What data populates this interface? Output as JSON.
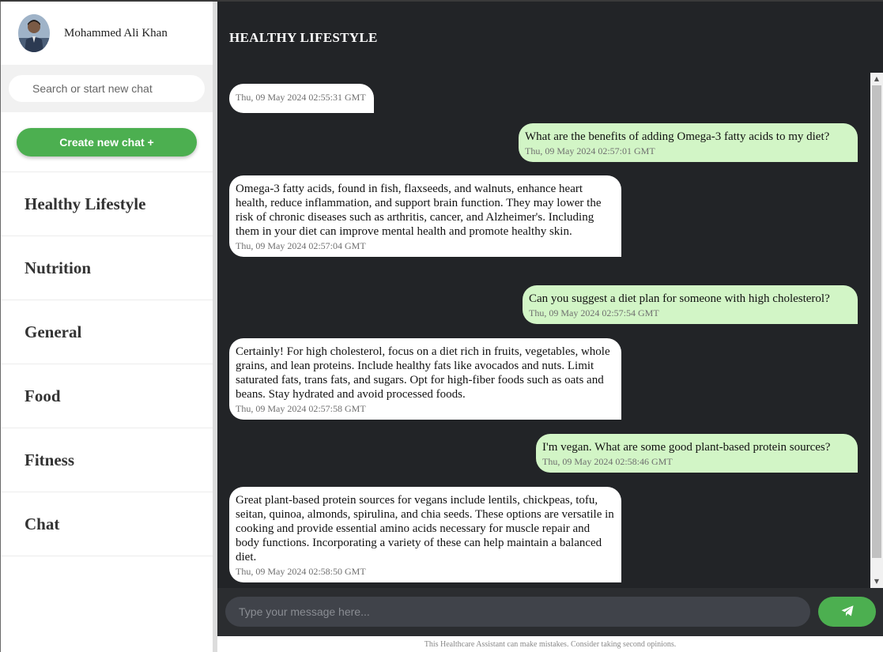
{
  "profile": {
    "name": "Mohammed Ali Khan"
  },
  "search": {
    "placeholder": "Search or start new chat"
  },
  "sidebar": {
    "new_chat_label": "Create new chat +",
    "items": [
      {
        "label": "Healthy Lifestyle"
      },
      {
        "label": "Nutrition"
      },
      {
        "label": "General"
      },
      {
        "label": "Food"
      },
      {
        "label": "Fitness"
      },
      {
        "label": "Chat"
      }
    ]
  },
  "main": {
    "title": "HEALTHY LIFESTYLE",
    "messages": [
      {
        "role": "bot",
        "text": "",
        "time": "Thu, 09 May 2024 02:55:31 GMT"
      },
      {
        "role": "user",
        "text": "What are the benefits of adding Omega-3 fatty acids to my diet?",
        "time": "Thu, 09 May 2024 02:57:01 GMT"
      },
      {
        "role": "bot",
        "text": "Omega-3 fatty acids, found in fish, flaxseeds, and walnuts, enhance heart health, reduce inflammation, and support brain function. They may lower the risk of chronic diseases such as arthritis, cancer, and Alzheimer's. Including them in your diet can improve mental health and promote healthy skin.",
        "time": "Thu, 09 May 2024 02:57:04 GMT"
      },
      {
        "role": "user",
        "text": "Can you suggest a diet plan for someone with high cholesterol?",
        "time": "Thu, 09 May 2024 02:57:54 GMT"
      },
      {
        "role": "bot",
        "text": "Certainly! For high cholesterol, focus on a diet rich in fruits, vegetables, whole grains, and lean proteins. Include healthy fats like avocados and nuts. Limit saturated fats, trans fats, and sugars. Opt for high-fiber foods such as oats and beans. Stay hydrated and avoid processed foods.",
        "time": "Thu, 09 May 2024 02:57:58 GMT"
      },
      {
        "role": "user",
        "text": "I'm vegan. What are some good plant-based protein sources?",
        "time": "Thu, 09 May 2024 02:58:46 GMT"
      },
      {
        "role": "bot",
        "text": "Great plant-based protein sources for vegans include lentils, chickpeas, tofu, seitan, quinoa, almonds, spirulina, and chia seeds. These options are versatile in cooking and provide essential amino acids necessary for muscle repair and body functions. Incorporating a variety of these can help maintain a balanced diet.",
        "time": "Thu, 09 May 2024 02:58:50 GMT"
      }
    ]
  },
  "composer": {
    "placeholder": "Type your message here...",
    "send_icon": "paper-plane-icon"
  },
  "footer": {
    "disclaimer": "This Healthcare Assistant can make mistakes. Consider taking second opinions."
  },
  "colors": {
    "accent": "#4caf50",
    "user_bubble": "#d2f5c6",
    "bot_bubble": "#ffffff",
    "chat_bg": "#222427"
  }
}
